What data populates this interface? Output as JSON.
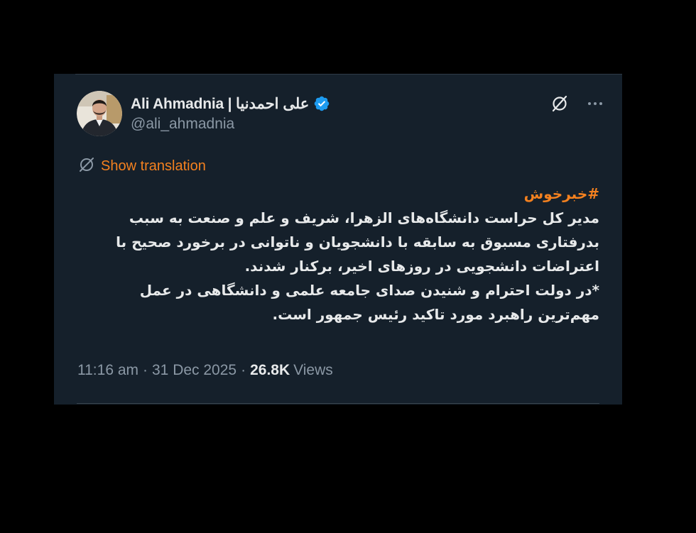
{
  "tweet": {
    "display_name": "Ali Ahmadnia | علی احمدنیا",
    "handle": "@ali_ahmadnia",
    "verified": true,
    "verified_icon": "verified-badge-icon",
    "grok_icon": "grok-icon",
    "more_icon": "more-icon",
    "translation": {
      "icon": "translate-icon",
      "label": "Show translation"
    },
    "hashtag": "#خبرخوش",
    "body_lines": [
      "مدیر کل حراست دانشگاه‌های الزهرا، شریف و علم و صنعت به سبب",
      "بدرفتاری مسبوق به سابقه با دانشجویان و ناتوانی در برخورد صحیح با",
      "اعتراضات دانشجویی در روزهای اخیر، برکنار شدند.",
      "*در دولت احترام و شنیدن صدای جامعه علمی و دانشگاهی در عمل",
      "مهم‌ترین راهبرد مورد تاکید رئیس جمهور است."
    ],
    "time": "11:16 am",
    "separator": "·",
    "date": "31 Dec 2025",
    "views_count": "26.8K",
    "views_label": "Views"
  },
  "colors": {
    "background": "#15202b",
    "accent": "#f4811f",
    "verified": "#1d9bf0",
    "text_primary": "#e7e9ea",
    "text_secondary": "#8b98a5"
  }
}
